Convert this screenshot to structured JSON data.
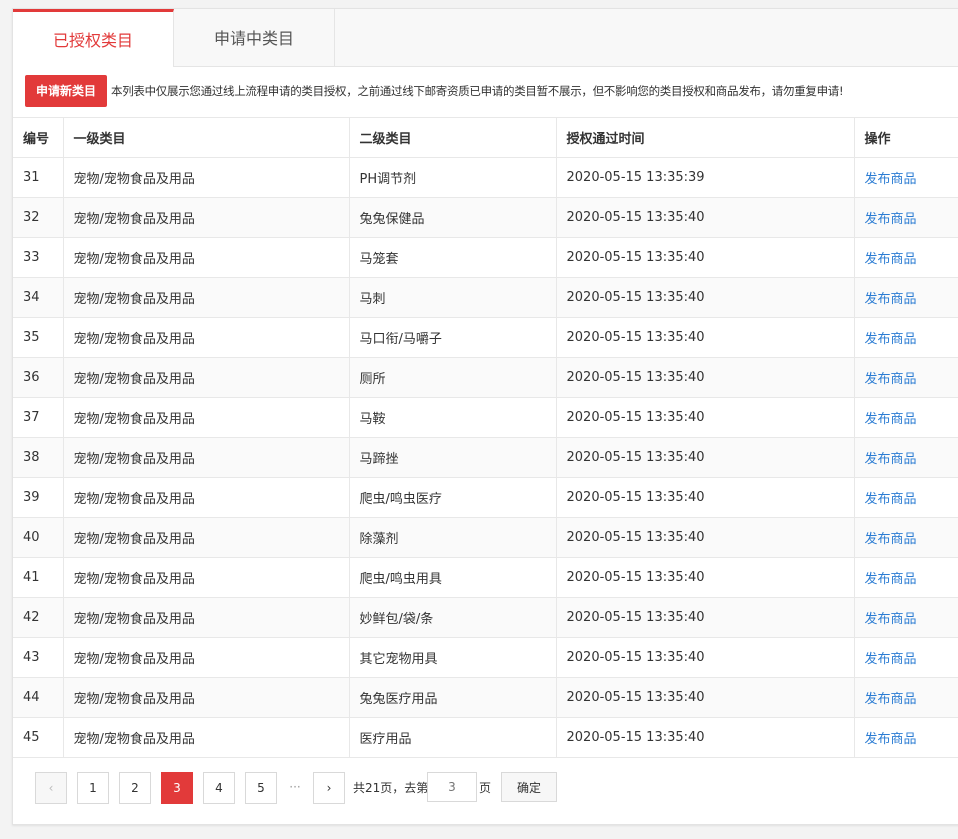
{
  "tabs": [
    "已授权类目",
    "申请中类目"
  ],
  "apply_button": "申请新类目",
  "notice": "本列表中仅展示您通过线上流程申请的类目授权，之前通过线下邮寄资质已申请的类目暂不展示，但不影响您的类目授权和商品发布，请勿重复申请!",
  "table": {
    "headers": [
      "编号",
      "一级类目",
      "二级类目",
      "授权通过时间",
      "操作"
    ],
    "rows": [
      {
        "id": "31",
        "cat1": "宠物/宠物食品及用品",
        "cat2": "PH调节剂",
        "time": "2020-05-15 13:35:39",
        "action": "发布商品"
      },
      {
        "id": "32",
        "cat1": "宠物/宠物食品及用品",
        "cat2": "兔兔保健品",
        "time": "2020-05-15 13:35:40",
        "action": "发布商品"
      },
      {
        "id": "33",
        "cat1": "宠物/宠物食品及用品",
        "cat2": "马笼套",
        "time": "2020-05-15 13:35:40",
        "action": "发布商品"
      },
      {
        "id": "34",
        "cat1": "宠物/宠物食品及用品",
        "cat2": "马刺",
        "time": "2020-05-15 13:35:40",
        "action": "发布商品"
      },
      {
        "id": "35",
        "cat1": "宠物/宠物食品及用品",
        "cat2": "马口衔/马嚼子",
        "time": "2020-05-15 13:35:40",
        "action": "发布商品"
      },
      {
        "id": "36",
        "cat1": "宠物/宠物食品及用品",
        "cat2": "厕所",
        "time": "2020-05-15 13:35:40",
        "action": "发布商品"
      },
      {
        "id": "37",
        "cat1": "宠物/宠物食品及用品",
        "cat2": "马鞍",
        "time": "2020-05-15 13:35:40",
        "action": "发布商品"
      },
      {
        "id": "38",
        "cat1": "宠物/宠物食品及用品",
        "cat2": "马蹄挫",
        "time": "2020-05-15 13:35:40",
        "action": "发布商品"
      },
      {
        "id": "39",
        "cat1": "宠物/宠物食品及用品",
        "cat2": "爬虫/鸣虫医疗",
        "time": "2020-05-15 13:35:40",
        "action": "发布商品"
      },
      {
        "id": "40",
        "cat1": "宠物/宠物食品及用品",
        "cat2": "除藻剂",
        "time": "2020-05-15 13:35:40",
        "action": "发布商品"
      },
      {
        "id": "41",
        "cat1": "宠物/宠物食品及用品",
        "cat2": "爬虫/鸣虫用具",
        "time": "2020-05-15 13:35:40",
        "action": "发布商品"
      },
      {
        "id": "42",
        "cat1": "宠物/宠物食品及用品",
        "cat2": "妙鲜包/袋/条",
        "time": "2020-05-15 13:35:40",
        "action": "发布商品"
      },
      {
        "id": "43",
        "cat1": "宠物/宠物食品及用品",
        "cat2": "其它宠物用具",
        "time": "2020-05-15 13:35:40",
        "action": "发布商品"
      },
      {
        "id": "44",
        "cat1": "宠物/宠物食品及用品",
        "cat2": "兔兔医疗用品",
        "time": "2020-05-15 13:35:40",
        "action": "发布商品"
      },
      {
        "id": "45",
        "cat1": "宠物/宠物食品及用品",
        "cat2": "医疗用品",
        "time": "2020-05-15 13:35:40",
        "action": "发布商品"
      }
    ]
  },
  "pagination": {
    "prev": "‹",
    "next": "›",
    "pages": [
      "1",
      "2",
      "3",
      "4",
      "5"
    ],
    "current": "3",
    "ellipsis": "···",
    "total_text": "共21页，去第",
    "input_placeholder": "3",
    "unit": "页",
    "confirm": "确定"
  },
  "colors": {
    "accent": "#e23a3a",
    "link": "#2b7cd3"
  }
}
